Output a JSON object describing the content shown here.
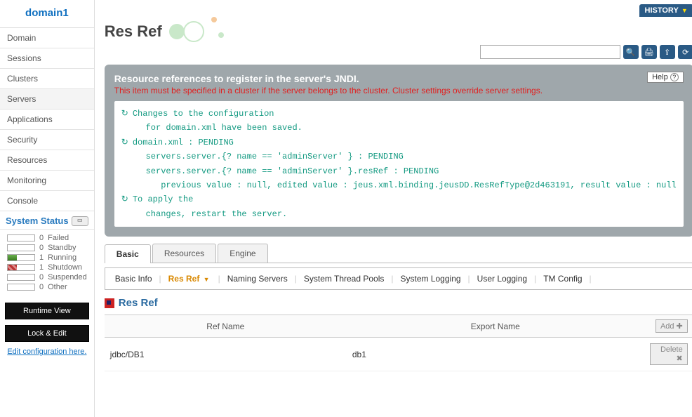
{
  "sidebar": {
    "domain": "domain1",
    "nav": [
      "Domain",
      "Sessions",
      "Clusters",
      "Servers",
      "Applications",
      "Security",
      "Resources",
      "Monitoring",
      "Console"
    ],
    "activeIndex": 3,
    "sysHeader": "System Status",
    "stats": [
      {
        "val": "0",
        "label": "Failed",
        "bar": ""
      },
      {
        "val": "0",
        "label": "Standby",
        "bar": ""
      },
      {
        "val": "1",
        "label": "Running",
        "bar": "green"
      },
      {
        "val": "1",
        "label": "Shutdown",
        "bar": "red"
      },
      {
        "val": "0",
        "label": "Suspended",
        "bar": ""
      },
      {
        "val": "0",
        "label": "Other",
        "bar": ""
      }
    ],
    "runtimeBtn": "Runtime View",
    "lockBtn": "Lock & Edit",
    "editLink": "Edit configuration here."
  },
  "topbar": {
    "history": "HISTORY"
  },
  "page": {
    "title": "Res Ref",
    "panelHeader": "Resource references to register in the server's JNDI.",
    "panelWarn": "This item must be specified in a cluster if the server belongs to the cluster. Cluster settings override server settings.",
    "help": "Help",
    "logLines": [
      {
        "sym": true,
        "text": "Changes to the configuration"
      },
      {
        "sym": false,
        "text": "   for domain.xml have been saved."
      },
      {
        "sym": true,
        "text": "domain.xml : PENDING"
      },
      {
        "sym": false,
        "text": "   servers.server.{? name == 'adminServer' } : PENDING"
      },
      {
        "sym": false,
        "text": "   servers.server.{? name == 'adminServer' }.resRef : PENDING"
      },
      {
        "sym": false,
        "text": "      previous value : null, edited value : jeus.xml.binding.jeusDD.ResRefType@2d463191, result value : null"
      },
      {
        "sym": true,
        "text": "To apply the"
      },
      {
        "sym": false,
        "text": "   changes, restart the server."
      }
    ],
    "tabs1": [
      "Basic",
      "Resources",
      "Engine"
    ],
    "tabs1Active": 0,
    "tabs2": [
      "Basic Info",
      "Res Ref",
      "Naming Servers",
      "System Thread Pools",
      "System Logging",
      "User Logging",
      "TM Config"
    ],
    "tabs2Active": 1,
    "sectionTitle": "Res Ref",
    "cols": {
      "ref": "Ref Name",
      "export": "Export Name"
    },
    "addBtn": "Add",
    "deleteBtn": "Delete",
    "rows": [
      {
        "ref": "jdbc/DB1",
        "export": "db1"
      }
    ]
  }
}
